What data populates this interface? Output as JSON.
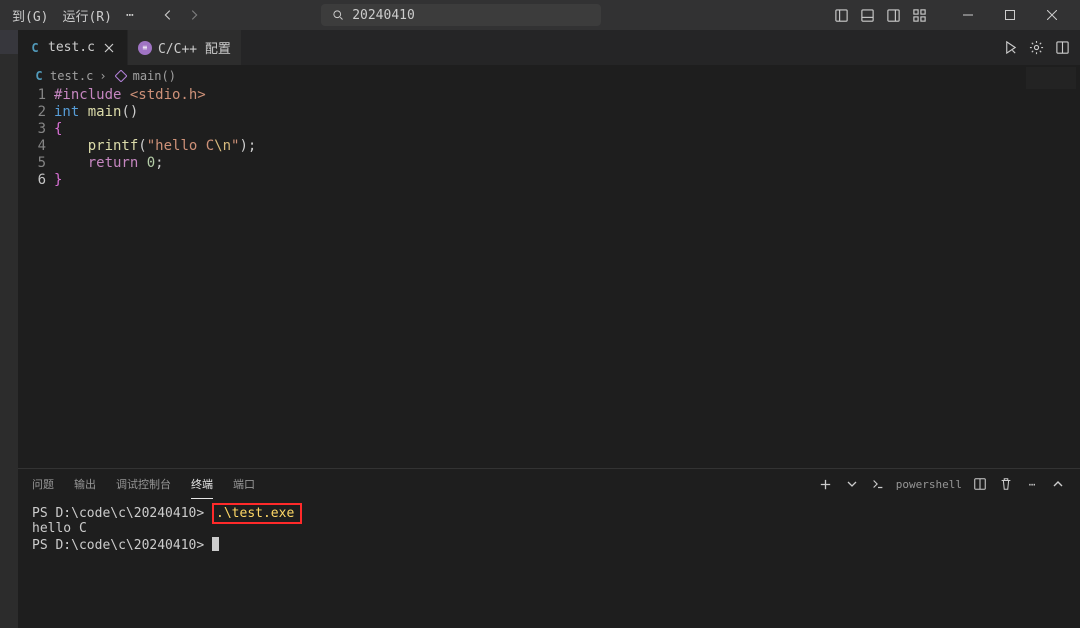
{
  "titlebar": {
    "menu_go": "到(G)",
    "menu_run": "运行(R)",
    "ellipsis": "⋯",
    "search_placeholder": "20240410"
  },
  "tabs": {
    "items": [
      {
        "icon": "C",
        "label": "test.c",
        "closeable": true,
        "active": true
      },
      {
        "icon": "cc",
        "label": "C/C++ 配置",
        "closeable": false,
        "active": false
      }
    ]
  },
  "breadcrumbs": {
    "file_icon": "C",
    "file": "test.c",
    "symbol": "main()"
  },
  "editor": {
    "lines": [
      {
        "n": "1",
        "tokens": [
          [
            "kw-include",
            "#include "
          ],
          [
            "inc-path",
            "<stdio.h>"
          ]
        ]
      },
      {
        "n": "2",
        "tokens": [
          [
            "kw",
            "int"
          ],
          [
            "",
            " "
          ],
          [
            "fn",
            "main"
          ],
          [
            "",
            "()"
          ]
        ]
      },
      {
        "n": "3",
        "tokens": [
          [
            "brace",
            "{"
          ]
        ]
      },
      {
        "n": "4",
        "tokens": [
          [
            "",
            "    "
          ],
          [
            "fn",
            "printf"
          ],
          [
            "",
            "("
          ],
          [
            "str",
            "\"hello C"
          ],
          [
            "esc",
            "\\n"
          ],
          [
            "str",
            "\""
          ],
          [
            "",
            ");"
          ]
        ]
      },
      {
        "n": "5",
        "tokens": [
          [
            "",
            "    "
          ],
          [
            "kw-include",
            "return"
          ],
          [
            "",
            " "
          ],
          [
            "num",
            "0"
          ],
          [
            "",
            ";"
          ]
        ]
      },
      {
        "n": "6",
        "tokens": [
          [
            "brace",
            "}"
          ]
        ]
      }
    ],
    "active_line": 6
  },
  "panel": {
    "tabs": [
      "问题",
      "输出",
      "调试控制台",
      "终端",
      "端口"
    ],
    "active_tab": 3,
    "terminal_kind": "powershell",
    "terminal": {
      "lines": [
        {
          "prompt": "PS D:\\code\\c\\20240410>",
          "cmd": ".\\test.exe",
          "highlight": true
        },
        {
          "plain": "hello C"
        },
        {
          "prompt": "PS D:\\code\\c\\20240410>",
          "cursor": true
        }
      ]
    }
  }
}
